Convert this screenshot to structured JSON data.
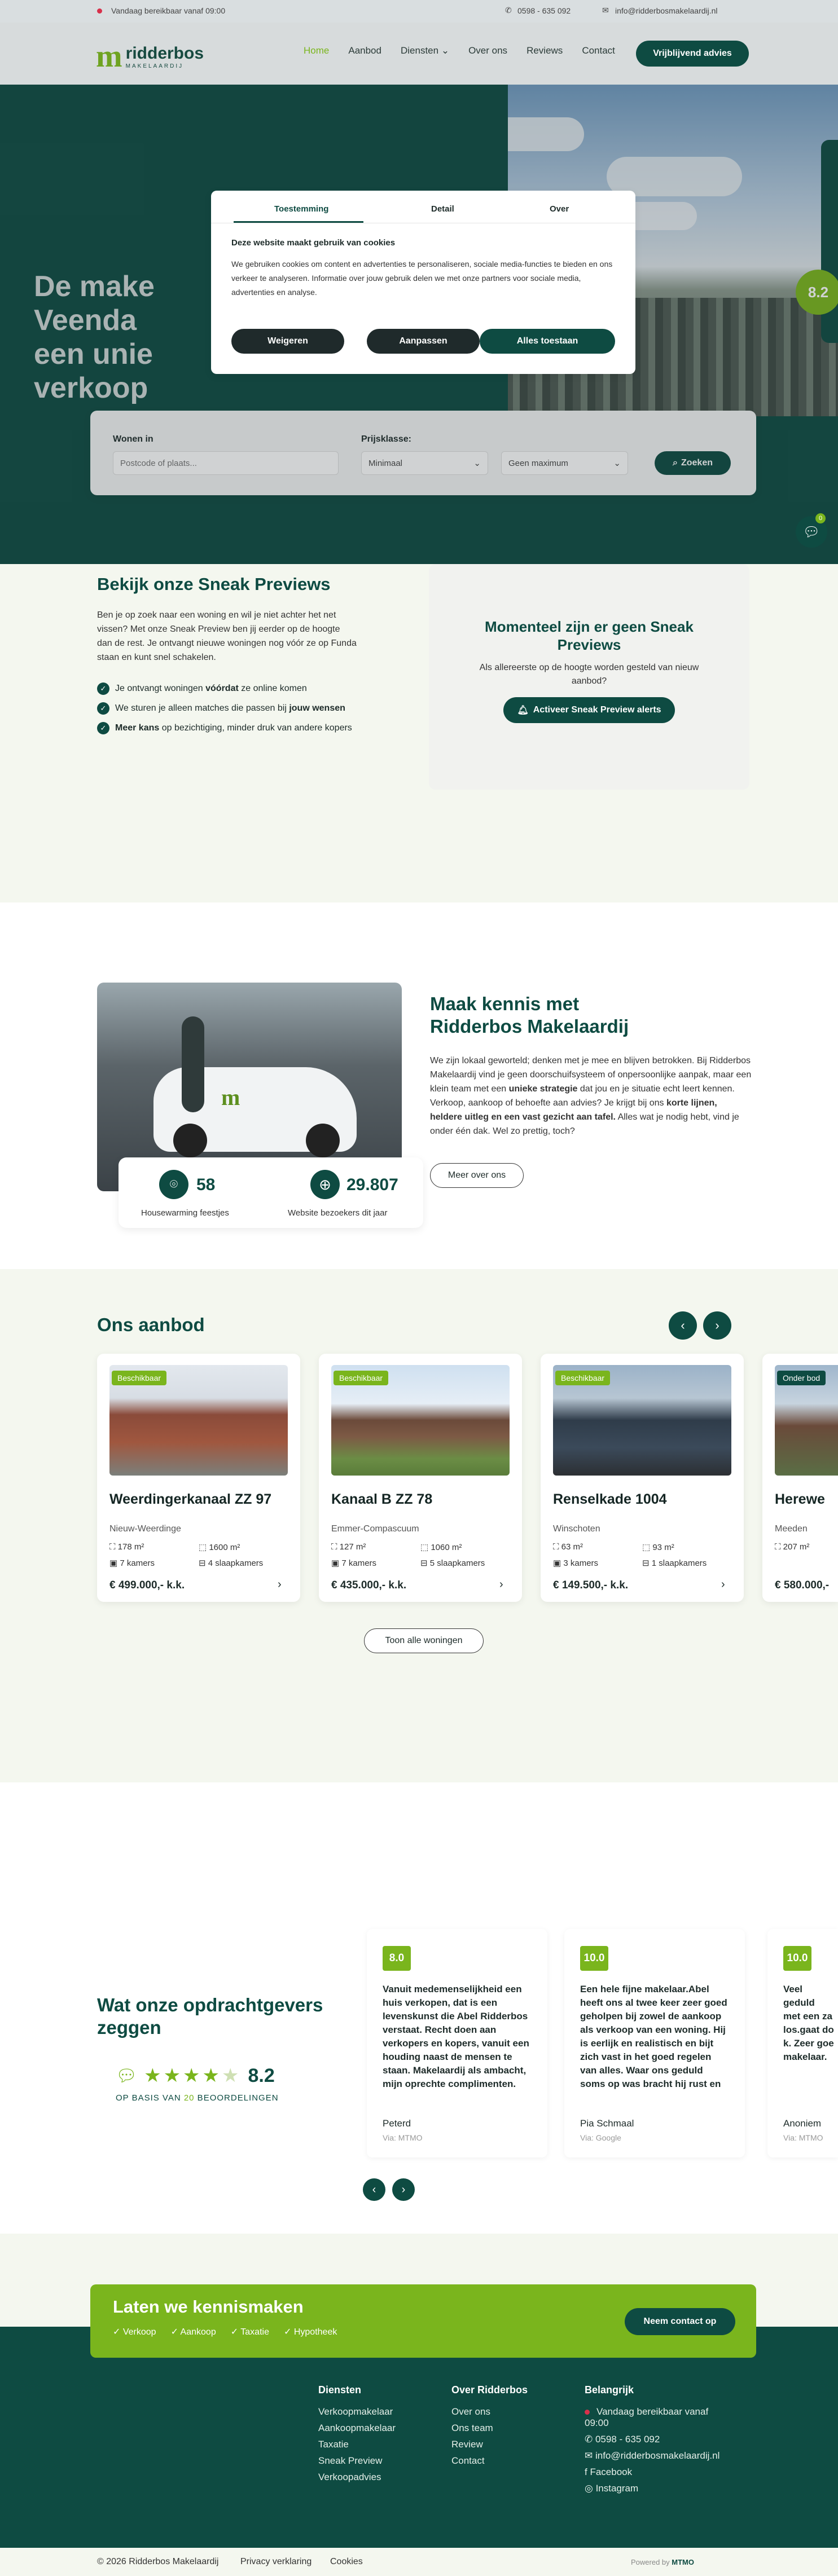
{
  "topbar": {
    "status": "Vandaag bereikbaar vanaf 09:00",
    "phone": "0598 - 635 092",
    "email": "info@ridderbosmakelaardij.nl"
  },
  "nav": {
    "logo_name": "ridderbos",
    "logo_sub": "MAKELAARDIJ",
    "items": [
      "Home",
      "Aanbod",
      "Diensten",
      "Over ons",
      "Reviews",
      "Contact"
    ],
    "cta": "Vrijblijvend advies"
  },
  "hero": {
    "line1": "De make",
    "line2": "Veenda",
    "line3": "een unie",
    "line4": "verkoop",
    "badge": "8.2"
  },
  "search": {
    "where_label": "Wonen in",
    "where_placeholder": "Postcode of plaats...",
    "price_label": "Prijsklasse:",
    "min": "Minimaal",
    "max": "Geen maximum",
    "button": "Zoeken"
  },
  "cookie": {
    "tabs": [
      "Toestemming",
      "Detail",
      "Over"
    ],
    "title": "Deze website maakt gebruik van cookies",
    "body": "We gebruiken cookies om content en advertenties te personaliseren, sociale media-functies te bieden en ons verkeer te analyseren. Informatie over jouw gebruik delen we met onze partners voor sociale media, advertenties en analyse.",
    "deny": "Weigeren",
    "customize": "Aanpassen",
    "allow": "Alles toestaan"
  },
  "sneak": {
    "title": "Bekijk onze Sneak Previews",
    "intro": "Ben je op zoek naar een woning en wil je niet achter het net vissen? Met onze Sneak Preview ben jij eerder op de hoogte dan de rest. Je ontvangt nieuwe woningen nog vóór ze op Funda staan en kunt snel schakelen.",
    "b1a": "Je ontvangt woningen ",
    "b1b": "vóórdat",
    "b1c": " ze online komen",
    "b2a": "We sturen je alleen matches die passen bij ",
    "b2b": "jouw wensen",
    "b3a": "Meer kans",
    "b3b": " op bezichtiging, minder druk van andere kopers",
    "box_title": "Momenteel zijn er geen Sneak Previews",
    "box_text": "Als allereerste op de hoogte worden gesteld van nieuw aanbod?",
    "box_btn": "Activeer Sneak Preview alerts"
  },
  "about": {
    "title1": "Maak kennis met",
    "title2": "Ridderbos Makelaardij",
    "p_a": "We zijn lokaal geworteld; denken met je mee en blijven betrokken. Bij Ridderbos Makelaardij vind je geen doorschuifsysteem of onpersoonlijke aanpak, maar een klein team met een ",
    "p_b": "unieke strategie",
    "p_c": " dat jou en je situatie echt leert kennen. Verkoop, aankoop of behoefte aan advies? Je krijgt bij ons ",
    "p_d": "korte lijnen, heldere uitleg en een vast gezicht aan tafel.",
    "p_e": " Alles wat je nodig hebt, vind je onder één dak. Wel zo prettig, toch?",
    "btn": "Meer over ons",
    "stat1_value": "58",
    "stat1_label": "Housewarming feestjes",
    "stat2_value": "29.807",
    "stat2_label": "Website bezoekers dit jaar"
  },
  "offer": {
    "title": "Ons aanbod",
    "all": "Toon alle woningen",
    "cards": [
      {
        "tag": "Beschikbaar",
        "title": "Weerdingerkanaal ZZ 97",
        "place": "Nieuw-Weerdinge",
        "area": "178 m²",
        "plot": "1600 m²",
        "rooms": "7 kamers",
        "bedrooms": "4 slaapkamers",
        "price": "€ 499.000,- k.k."
      },
      {
        "tag": "Beschikbaar",
        "title": "Kanaal B ZZ 78",
        "place": "Emmer-Compascuum",
        "area": "127 m²",
        "plot": "1060 m²",
        "rooms": "7 kamers",
        "bedrooms": "5 slaapkamers",
        "price": "€ 435.000,- k.k."
      },
      {
        "tag": "Beschikbaar",
        "title": "Renselkade 1004",
        "place": "Winschoten",
        "area": "63 m²",
        "plot": "93 m²",
        "rooms": "3 kamers",
        "bedrooms": "1 slaapkamers",
        "price": "€ 149.500,- k.k."
      },
      {
        "tag": "Onder bod",
        "title": "Herewe",
        "place": "Meeden",
        "area": "207 m²",
        "plot": "",
        "rooms": "",
        "bedrooms": "",
        "price": "€ 580.000,-"
      }
    ]
  },
  "reviews": {
    "title1": "Wat onze opdrachtgevers",
    "title2": "zeggen",
    "rating": "8.2",
    "basis_a": "OP BASIS VAN ",
    "basis_b": "20",
    "basis_c": " BEOORDELINGEN",
    "items": [
      {
        "score": "8.0",
        "text": "Vanuit medemenselijkheid een huis verkopen, dat is een levenskunst die Abel Ridderbos verstaat. Recht doen aan verkopers en kopers, vanuit een houding naast de mensen te staan. Makelaardij als ambacht, mijn oprechte complimenten.",
        "name": "Peterd",
        "source": "Via: MTMO"
      },
      {
        "score": "10.0",
        "text": "Een hele fijne makelaar.Abel heeft ons al twee keer zeer goed geholpen bij zowel de aankoop als verkoop van een woning. Hij is eerlijk en realistisch en bijt zich vast in het goed regelen van alles. Waar ons geduld soms op was bracht hij rust en",
        "name": "Pia Schmaal",
        "source": "Via: Google"
      },
      {
        "score": "10.0",
        "text": "Veel geduld met een za los.gaat do k. Zeer goe makelaar.",
        "name": "Anoniem",
        "source": "Via: MTMO"
      }
    ]
  },
  "cta": {
    "title": "Laten we kennismaken",
    "items": [
      "Verkoop",
      "Aankoop",
      "Taxatie",
      "Hypotheek"
    ],
    "btn": "Neem contact op"
  },
  "footer": {
    "col1_title": "Diensten",
    "col1": [
      "Verkoopmakelaar",
      "Aankoopmakelaar",
      "Taxatie",
      "Sneak Preview",
      "Verkoopadvies"
    ],
    "col2_title": "Over Ridderbos",
    "col2": [
      "Over ons",
      "Ons team",
      "Review",
      "Contact"
    ],
    "col3_title": "Belangrijk",
    "status1": "Vandaag bereikbaar vanaf",
    "status2": "09:00",
    "phone": "0598 - 635 092",
    "email": "info@ridderbosmakelaardij.nl",
    "facebook": "Facebook",
    "instagram": "Instagram",
    "copyright": "© 2026 Ridderbos Makelaardij",
    "privacy": "Privacy verklaring",
    "cookies": "Cookies",
    "powered": "Powered by",
    "powered_brand": "MTMO"
  },
  "chat": {
    "badge": "0"
  }
}
